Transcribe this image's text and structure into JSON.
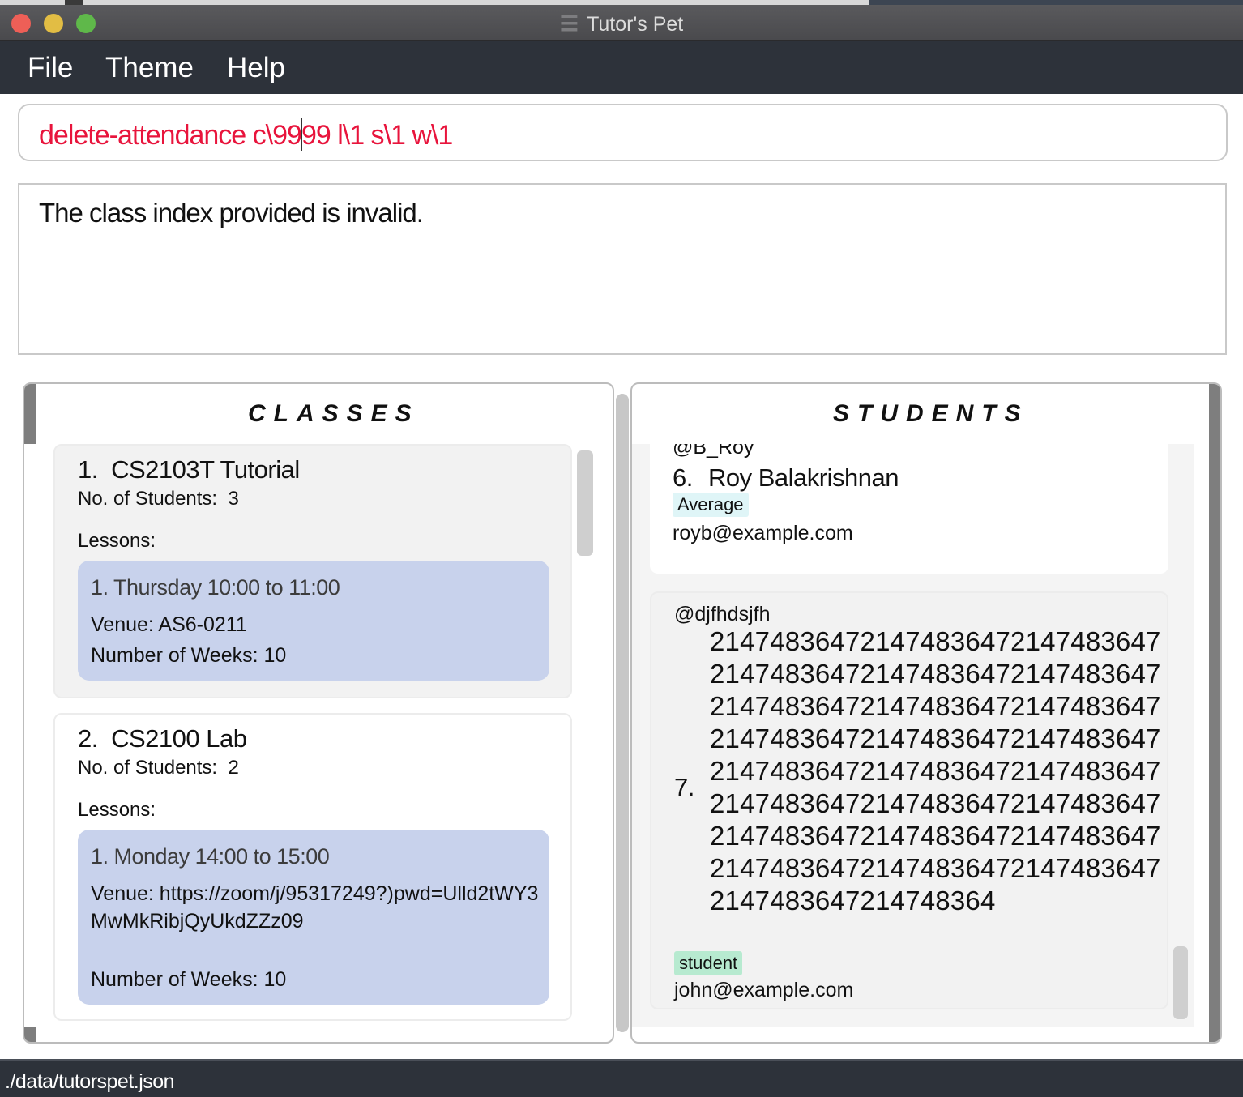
{
  "window": {
    "title": "Tutor's Pet",
    "icon": "tutors-pet-logo-icon"
  },
  "menu": {
    "file": "File",
    "theme": "Theme",
    "help": "Help"
  },
  "command": {
    "before_caret": "delete-attendance c\\99",
    "after_caret": "99 l\\1 s\\1 w\\1",
    "text_color": "#e8143c"
  },
  "result": {
    "message": "The class index provided is invalid."
  },
  "classes_panel": {
    "title": "CLASSES",
    "items": [
      {
        "title": "1.  CS2103T Tutorial",
        "students": "No. of Students:  3",
        "lessons_label": "Lessons:",
        "lessons": [
          {
            "title": "1. Thursday 10:00 to 11:00",
            "venue": "Venue: AS6-0211",
            "weeks": "Number of Weeks: 10"
          }
        ]
      },
      {
        "title": "2.  CS2100 Lab",
        "students": "No. of Students:  2",
        "lessons_label": "Lessons:",
        "lessons": [
          {
            "title": "1. Monday 14:00 to 15:00",
            "venue": "Venue: https://zoom/j/95317249?)pwd=Ulld2tWY3MwMkRibjQyUkdZZz09",
            "weeks": "Number of Weeks: 10"
          }
        ]
      }
    ]
  },
  "students_panel": {
    "title": "STUDENTS",
    "items": [
      {
        "handle": "@B_Roy",
        "index": "6.",
        "name": "Roy Balakrishnan",
        "tag": "Average",
        "email": "royb@example.com"
      },
      {
        "handle": "@djfhdsjfh",
        "index": "7.",
        "name": "2147483647214748364721474836472147483647214748364721474836472147483647214748364721474836472147483647214748364721474836472147483647214748364721474836472147483647214748364721474836472147483647214748364721474836472147483647214748364721474836472147483647214748364",
        "tag": "student",
        "email": "john@example.com"
      }
    ]
  },
  "status": {
    "path": "./data/tutorspet.json"
  },
  "colors": {
    "menubar": "#2d323a",
    "lesson_bg": "#c8d2ec",
    "tag_average": "#dff5f7",
    "tag_student": "#b7ead0"
  }
}
